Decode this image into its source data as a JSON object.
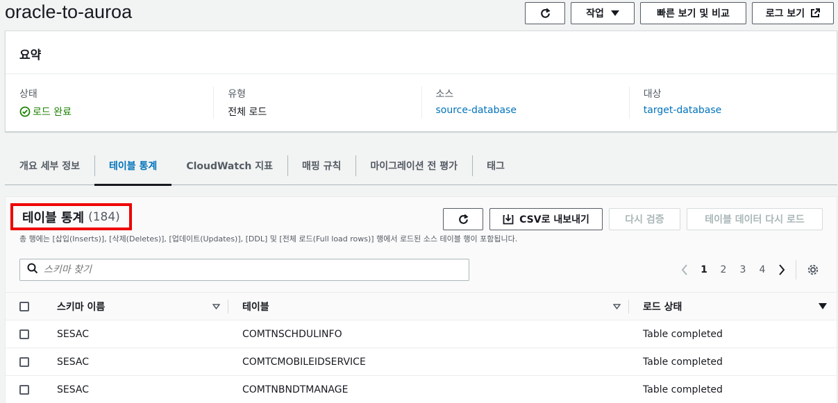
{
  "header": {
    "title": "oracle-to-auroa",
    "actions_label": "작업",
    "quick_view_label": "빠른 보기 및 비교",
    "logs_label": "로그 보기"
  },
  "summary": {
    "title": "요약",
    "fields": [
      {
        "label": "상태",
        "value": "로드 완료"
      },
      {
        "label": "유형",
        "value": "전체 로드"
      },
      {
        "label": "소스",
        "value": "source-database"
      },
      {
        "label": "대상",
        "value": "target-database"
      }
    ]
  },
  "tabs": [
    {
      "label": "개요 세부 정보"
    },
    {
      "label": "테이블 통계"
    },
    {
      "label": "CloudWatch 지표"
    },
    {
      "label": "매핑 규칙"
    },
    {
      "label": "마이그레이션 전 평가"
    },
    {
      "label": "태그"
    }
  ],
  "panel": {
    "title": "테이블 통계",
    "count": "(184)",
    "description": "총 행에는 [삽입(Inserts)], [삭제(Deletes)], [업데이트(Updates)], [DDL] 및 [전체 로드(Full load rows)] 행에서 로드된 소스 테이블 행이 포함됩니다.",
    "export_label": "CSV로 내보내기",
    "revalidate_label": "다시 검증",
    "reload_label": "테이블 데이터 다시 로드",
    "search_placeholder": "스키마 찾기",
    "pages": [
      "1",
      "2",
      "3",
      "4"
    ],
    "current_page": "1"
  },
  "table": {
    "columns": [
      "스키마 이름",
      "테이블",
      "로드 상태"
    ],
    "rows": [
      {
        "schema": "SESAC",
        "table": "COMTNSCHDULINFO",
        "status": "Table completed"
      },
      {
        "schema": "SESAC",
        "table": "COMTCMOBILEIDSERVICE",
        "status": "Table completed"
      },
      {
        "schema": "SESAC",
        "table": "COMTNBNDTMANAGE",
        "status": "Table completed"
      }
    ]
  },
  "colors": {
    "link": "#0073bb",
    "success": "#1d8102",
    "highlight_box": "#ee0000"
  }
}
